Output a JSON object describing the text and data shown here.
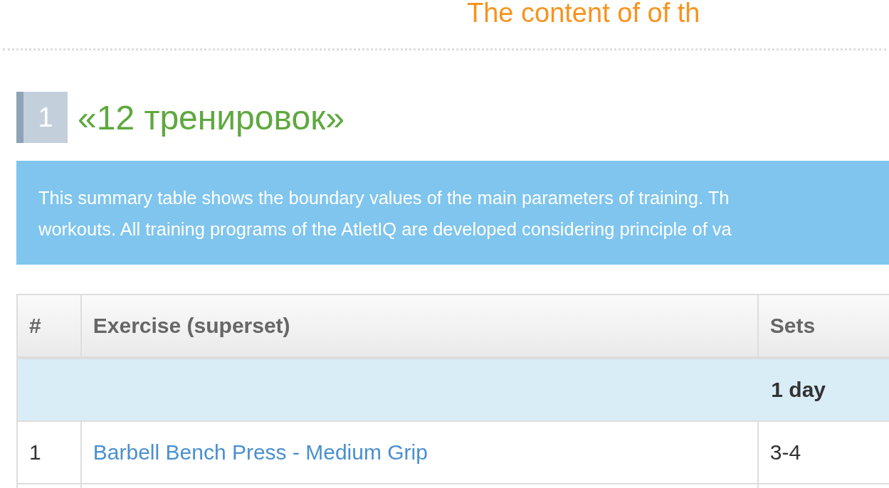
{
  "page_title": "The content of of th",
  "section": {
    "number": "1",
    "title": "«12 тренировок»"
  },
  "info": [
    "This summary table shows the boundary values of the main parameters of training. Th",
    "workouts. All training programs of the AtletIQ are developed considering principle of va"
  ],
  "table": {
    "columns": [
      "#",
      "Exercise (superset)",
      "Sets"
    ],
    "groups": [
      {
        "label": "1 day",
        "rows": [
          {
            "number": "1",
            "exercise": "Barbell Bench Press - Medium Grip",
            "sets": "3-4"
          }
        ]
      }
    ]
  }
}
